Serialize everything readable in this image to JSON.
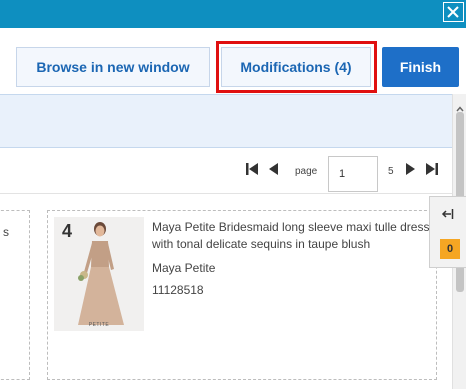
{
  "toolbar": {
    "browse_label": "Browse in new window",
    "modifications_label": "Modifications (4)",
    "finish_label": "Finish"
  },
  "pager": {
    "page_label": "page",
    "page_value": "1",
    "total_pages": "5"
  },
  "left_card": {
    "text": "s"
  },
  "product": {
    "number": "4",
    "title": "Maya Petite Bridesmaid long sleeve maxi tulle dress with tonal delicate sequins in taupe blush",
    "brand": "Maya Petite",
    "sku": "11128518",
    "image_caption": "PETITE"
  },
  "side_panel": {
    "badge_count": "0"
  },
  "colors": {
    "titlebar": "#0e8fc0",
    "accent_blue": "#1e6fc8",
    "highlight_red": "#e01010",
    "badge_orange": "#f5a623"
  }
}
